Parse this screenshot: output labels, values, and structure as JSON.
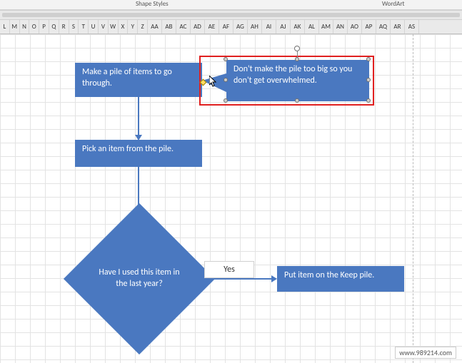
{
  "ribbon": {
    "shapeStyles": "Shape Styles",
    "wordArt": "WordArt"
  },
  "columns": [
    "L",
    "M",
    "N",
    "O",
    "P",
    "Q",
    "R",
    "S",
    "T",
    "U",
    "V",
    "W",
    "X",
    "Y",
    "Z",
    "AA",
    "AB",
    "AC",
    "AD",
    "AE",
    "AF",
    "AG",
    "AH",
    "AI",
    "AJ",
    "AK",
    "AL",
    "AM",
    "AN",
    "AO",
    "AP",
    "AQ",
    "AR",
    "AS"
  ],
  "boxes": {
    "makePile": "Make a pile of items to go through.",
    "pickItem": "Pick an item from the pile.",
    "decision": "Have I used this item in the last year?",
    "yes": "Yes",
    "keepPile": "Put item on the Keep pile.",
    "callout": "Don't make the pile too big so you don't get overwhelmed."
  },
  "colors": {
    "shape": "#4a78c0",
    "highlight": "#e02020"
  },
  "watermark": "www.989214.com"
}
